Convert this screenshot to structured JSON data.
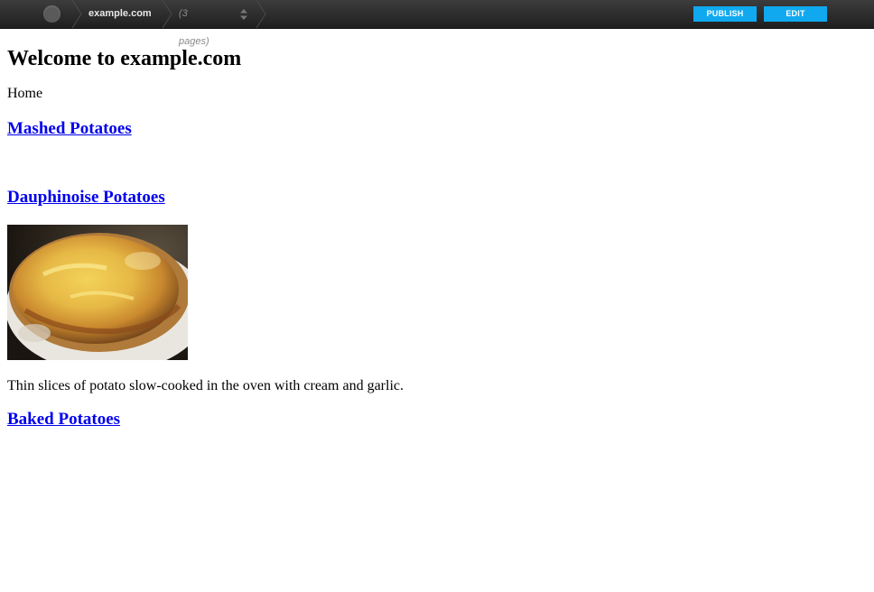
{
  "toolbar": {
    "site_name": "example.com",
    "page_count": "(3 pages)",
    "publish_label": "PUBLISH",
    "edit_label": "EDIT",
    "accent_color": "#10a9ef"
  },
  "page": {
    "title": "Welcome to example.com",
    "breadcrumb": "Home",
    "items": [
      {
        "title": "Mashed Potatoes"
      },
      {
        "title": "Dauphinoise Potatoes",
        "description": "Thin slices of potato slow-cooked in the oven with cream and garlic."
      },
      {
        "title": "Baked Potatoes"
      }
    ]
  }
}
